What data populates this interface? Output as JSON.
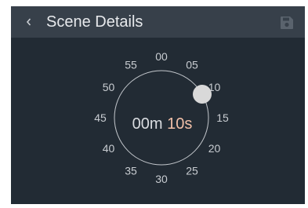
{
  "header": {
    "title": "Scene Details",
    "back_icon": "chevron-left-icon",
    "save_icon": "floppy-disk-icon"
  },
  "dial": {
    "tick_labels": [
      "00",
      "05",
      "10",
      "15",
      "20",
      "25",
      "30",
      "35",
      "40",
      "45",
      "50",
      "55"
    ],
    "readout": {
      "minutes": "00m",
      "seconds": "10s"
    },
    "handle_value_seconds": 10
  },
  "colors": {
    "background": "#222b34",
    "header": "#37404a",
    "accent_seconds": "#f2c0a8",
    "handle": "#d9d9d9"
  }
}
